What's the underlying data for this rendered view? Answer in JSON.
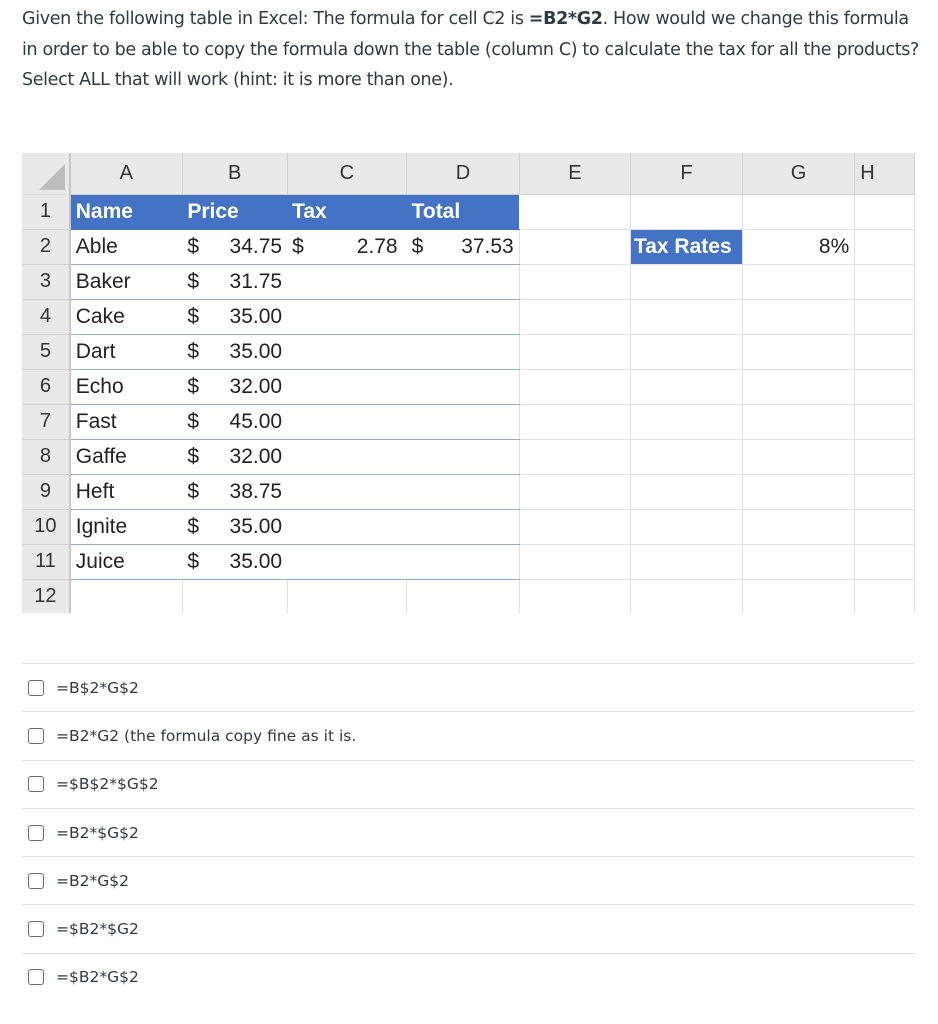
{
  "question": {
    "text_before": "Given the following table in Excel:  The formula for cell C2 is ",
    "formula": "=B2*G2",
    "text_after": ".  How would we change this formula in order to be able to copy the formula down the table (column C) to calculate the tax for all the products?  Select ALL that will work (hint:  it is more than one)."
  },
  "spreadsheet": {
    "columns": [
      "A",
      "B",
      "C",
      "D",
      "E",
      "F",
      "G",
      "H"
    ],
    "row_numbers": [
      "1",
      "2",
      "3",
      "4",
      "5",
      "6",
      "7",
      "8",
      "9",
      "10",
      "11",
      "12"
    ],
    "headers": {
      "name": "Name",
      "price": "Price",
      "tax": "Tax",
      "total": "Total"
    },
    "rows": [
      {
        "name": "Able",
        "price": "34.75",
        "tax": "2.78",
        "total": "37.53"
      },
      {
        "name": "Baker",
        "price": "31.75",
        "tax": "",
        "total": ""
      },
      {
        "name": "Cake",
        "price": "35.00",
        "tax": "",
        "total": ""
      },
      {
        "name": "Dart",
        "price": "35.00",
        "tax": "",
        "total": ""
      },
      {
        "name": "Echo",
        "price": "32.00",
        "tax": "",
        "total": ""
      },
      {
        "name": "Fast",
        "price": "45.00",
        "tax": "",
        "total": ""
      },
      {
        "name": "Gaffe",
        "price": "32.00",
        "tax": "",
        "total": ""
      },
      {
        "name": "Heft",
        "price": "38.75",
        "tax": "",
        "total": ""
      },
      {
        "name": "Ignite",
        "price": "35.00",
        "tax": "",
        "total": ""
      },
      {
        "name": "Juice",
        "price": "35.00",
        "tax": "",
        "total": ""
      }
    ],
    "currency_symbol": "$",
    "tax_rate_label": "Tax Rates",
    "tax_rate_value": "8%",
    "header_color": "#4472c4"
  },
  "options": [
    {
      "label": "=B$2*G$2",
      "checked": false
    },
    {
      "label": "=B2*G2 (the formula copy fine as it is.",
      "checked": false
    },
    {
      "label": "=$B$2*$G$2",
      "checked": false
    },
    {
      "label": "=B2*$G$2",
      "checked": false
    },
    {
      "label": "=B2*G$2",
      "checked": false
    },
    {
      "label": "=$B2*$G2",
      "checked": false
    },
    {
      "label": "=$B2*G$2",
      "checked": false
    }
  ]
}
